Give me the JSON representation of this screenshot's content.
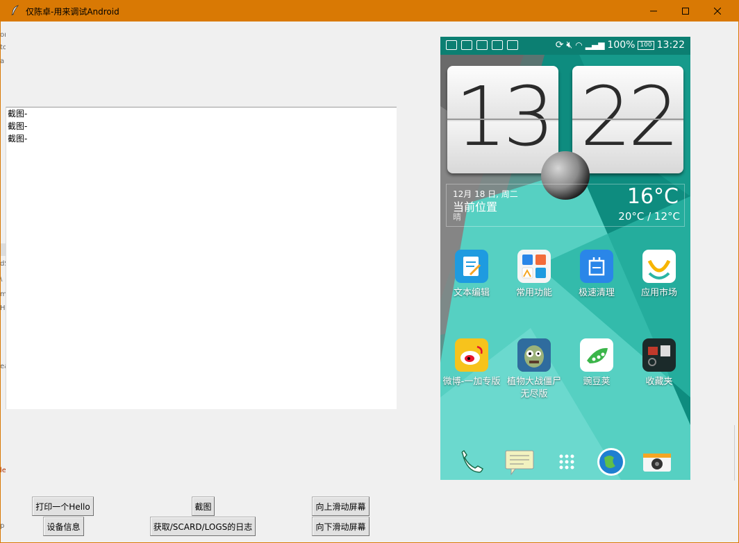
{
  "window": {
    "title": "仅陈卓-用来调试Android",
    "controls": [
      "minimize-icon",
      "maximize-icon",
      "close-icon"
    ],
    "accent": "#d97904"
  },
  "edge_fragments": [
    "on",
    "to",
    "a",
    "dS",
    "\\",
    "m",
    "H",
    "ea",
    "le",
    "p"
  ],
  "log": {
    "lines": [
      "截图-",
      "截图-",
      "截图-"
    ]
  },
  "buttons": {
    "print_hello": "打印一个Hello",
    "device_info": "设备信息",
    "screenshot": "截图",
    "get_logs": "获取/SCARD/LOGS的日志",
    "scroll_up": "向上滑动屏幕",
    "scroll_down": "向下滑动屏幕"
  },
  "phone": {
    "status": {
      "battery_pct": "100%",
      "battery_icon": "100",
      "time": "13:22"
    },
    "clock": {
      "hour": "13",
      "minute": "22"
    },
    "weather": {
      "date": "12月 18 日, 周二",
      "location": "当前位置",
      "condition": "晴",
      "temp": "16°C",
      "range": "20°C / 12°C"
    },
    "apps": [
      {
        "label": "文本编辑",
        "icon": "text-editor-icon",
        "color": "#1e9be0"
      },
      {
        "label": "常用功能",
        "icon": "tools-folder-icon",
        "color": "#f5f5f5"
      },
      {
        "label": "极速清理",
        "icon": "cleaner-icon",
        "color": "#2a86e8"
      },
      {
        "label": "应用市场",
        "icon": "app-market-icon",
        "color": "#ffffff"
      },
      {
        "label": "微博-一加专版",
        "icon": "weibo-icon",
        "color": "#f7c31c"
      },
      {
        "label": "植物大战僵尸无尽版",
        "icon": "pvz-icon",
        "color": "#4c8f3a"
      },
      {
        "label": "豌豆荚",
        "icon": "wandoujia-icon",
        "color": "#ffffff"
      },
      {
        "label": "收藏夹",
        "icon": "bookmarks-icon",
        "color": "#1b2a2a"
      }
    ],
    "dock": [
      "phone-icon",
      "messages-icon",
      "app-drawer-icon",
      "browser-icon",
      "camera-icon"
    ]
  }
}
